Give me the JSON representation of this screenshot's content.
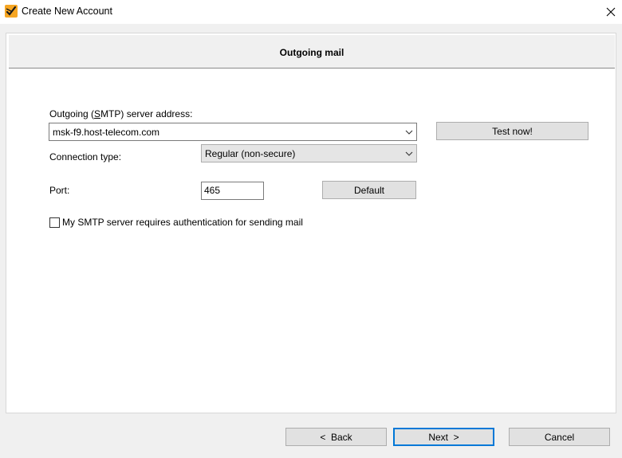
{
  "window": {
    "title": "Create New Account",
    "icon": "app-logo-icon",
    "close_icon": "close-icon"
  },
  "page": {
    "header_title": "Outgoing mail"
  },
  "smtp": {
    "label_pre": "Outgoing (",
    "label_mnemonic": "S",
    "label_post": "MTP) server address:",
    "value": "msk-f9.host-telecom.com",
    "test_button": "Test now!"
  },
  "connection": {
    "label": "Connection type:",
    "value": "Regular (non-secure)"
  },
  "port": {
    "label": "Port:",
    "value": "465",
    "default_button": "Default"
  },
  "auth": {
    "checked": false,
    "label": "My SMTP server requires authentication for sending mail"
  },
  "footer": {
    "back": "<  Back",
    "next": "Next  >",
    "cancel": "Cancel"
  }
}
